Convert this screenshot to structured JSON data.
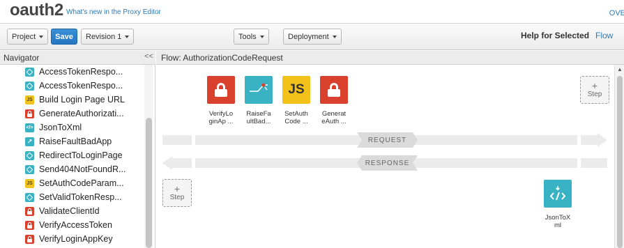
{
  "header": {
    "app_title": "oauth2",
    "whats_new": "What's new in the Proxy Editor",
    "overflow_link": "OVE"
  },
  "toolbar": {
    "project_label": "Project",
    "save_label": "Save",
    "revision_label": "Revision 1",
    "tools_label": "Tools",
    "deployment_label": "Deployment",
    "help_label": "Help for Selected",
    "help_topic": "Flow"
  },
  "navigator": {
    "title": "Navigator",
    "collapse_glyph": "<<",
    "items": [
      {
        "label": "AccessTokenRespo...",
        "icon": "assign-message-icon"
      },
      {
        "label": "AccessTokenRespo...",
        "icon": "assign-message-icon"
      },
      {
        "label": "Build Login Page URL",
        "icon": "javascript-icon"
      },
      {
        "label": "GenerateAuthorizati...",
        "icon": "oauth-lock-icon"
      },
      {
        "label": "JsonToXml",
        "icon": "json-to-xml-icon"
      },
      {
        "label": "RaiseFaultBadApp",
        "icon": "raise-fault-icon"
      },
      {
        "label": "RedirectToLoginPage",
        "icon": "assign-message-icon"
      },
      {
        "label": "Send404NotFoundR...",
        "icon": "assign-message-icon"
      },
      {
        "label": "SetAuthCodeParam...",
        "icon": "javascript-icon"
      },
      {
        "label": "SetValidTokenResp...",
        "icon": "assign-message-icon"
      },
      {
        "label": "ValidateClientId",
        "icon": "oauth-lock-icon"
      },
      {
        "label": "VerifyAccessToken",
        "icon": "oauth-lock-icon"
      },
      {
        "label": "VerifyLoginAppKey",
        "icon": "oauth-lock-icon"
      }
    ]
  },
  "flow": {
    "title": "Flow: AuthorizationCodeRequest",
    "request_label": "REQUEST",
    "response_label": "RESPONSE",
    "step_plus": "+",
    "step_label": "Step",
    "request_policies": [
      {
        "line1": "VerifyLo",
        "line2": "ginAp ...",
        "icon": "oauth-lock-icon",
        "color": "#d9412c"
      },
      {
        "line1": "RaiseFa",
        "line2": "ultBad...",
        "icon": "raise-fault-icon",
        "color": "#39b3c4"
      },
      {
        "line1": "SetAuth",
        "line2": "Code ...",
        "icon": "javascript-icon",
        "color": "#f2c21a"
      },
      {
        "line1": "Generat",
        "line2": "eAuth ...",
        "icon": "oauth-lock-icon",
        "color": "#d9412c"
      }
    ],
    "response_policies": [
      {
        "line1": "JsonToX",
        "line2": "ml",
        "icon": "json-to-xml-icon",
        "color": "#39b3c4"
      }
    ]
  }
}
